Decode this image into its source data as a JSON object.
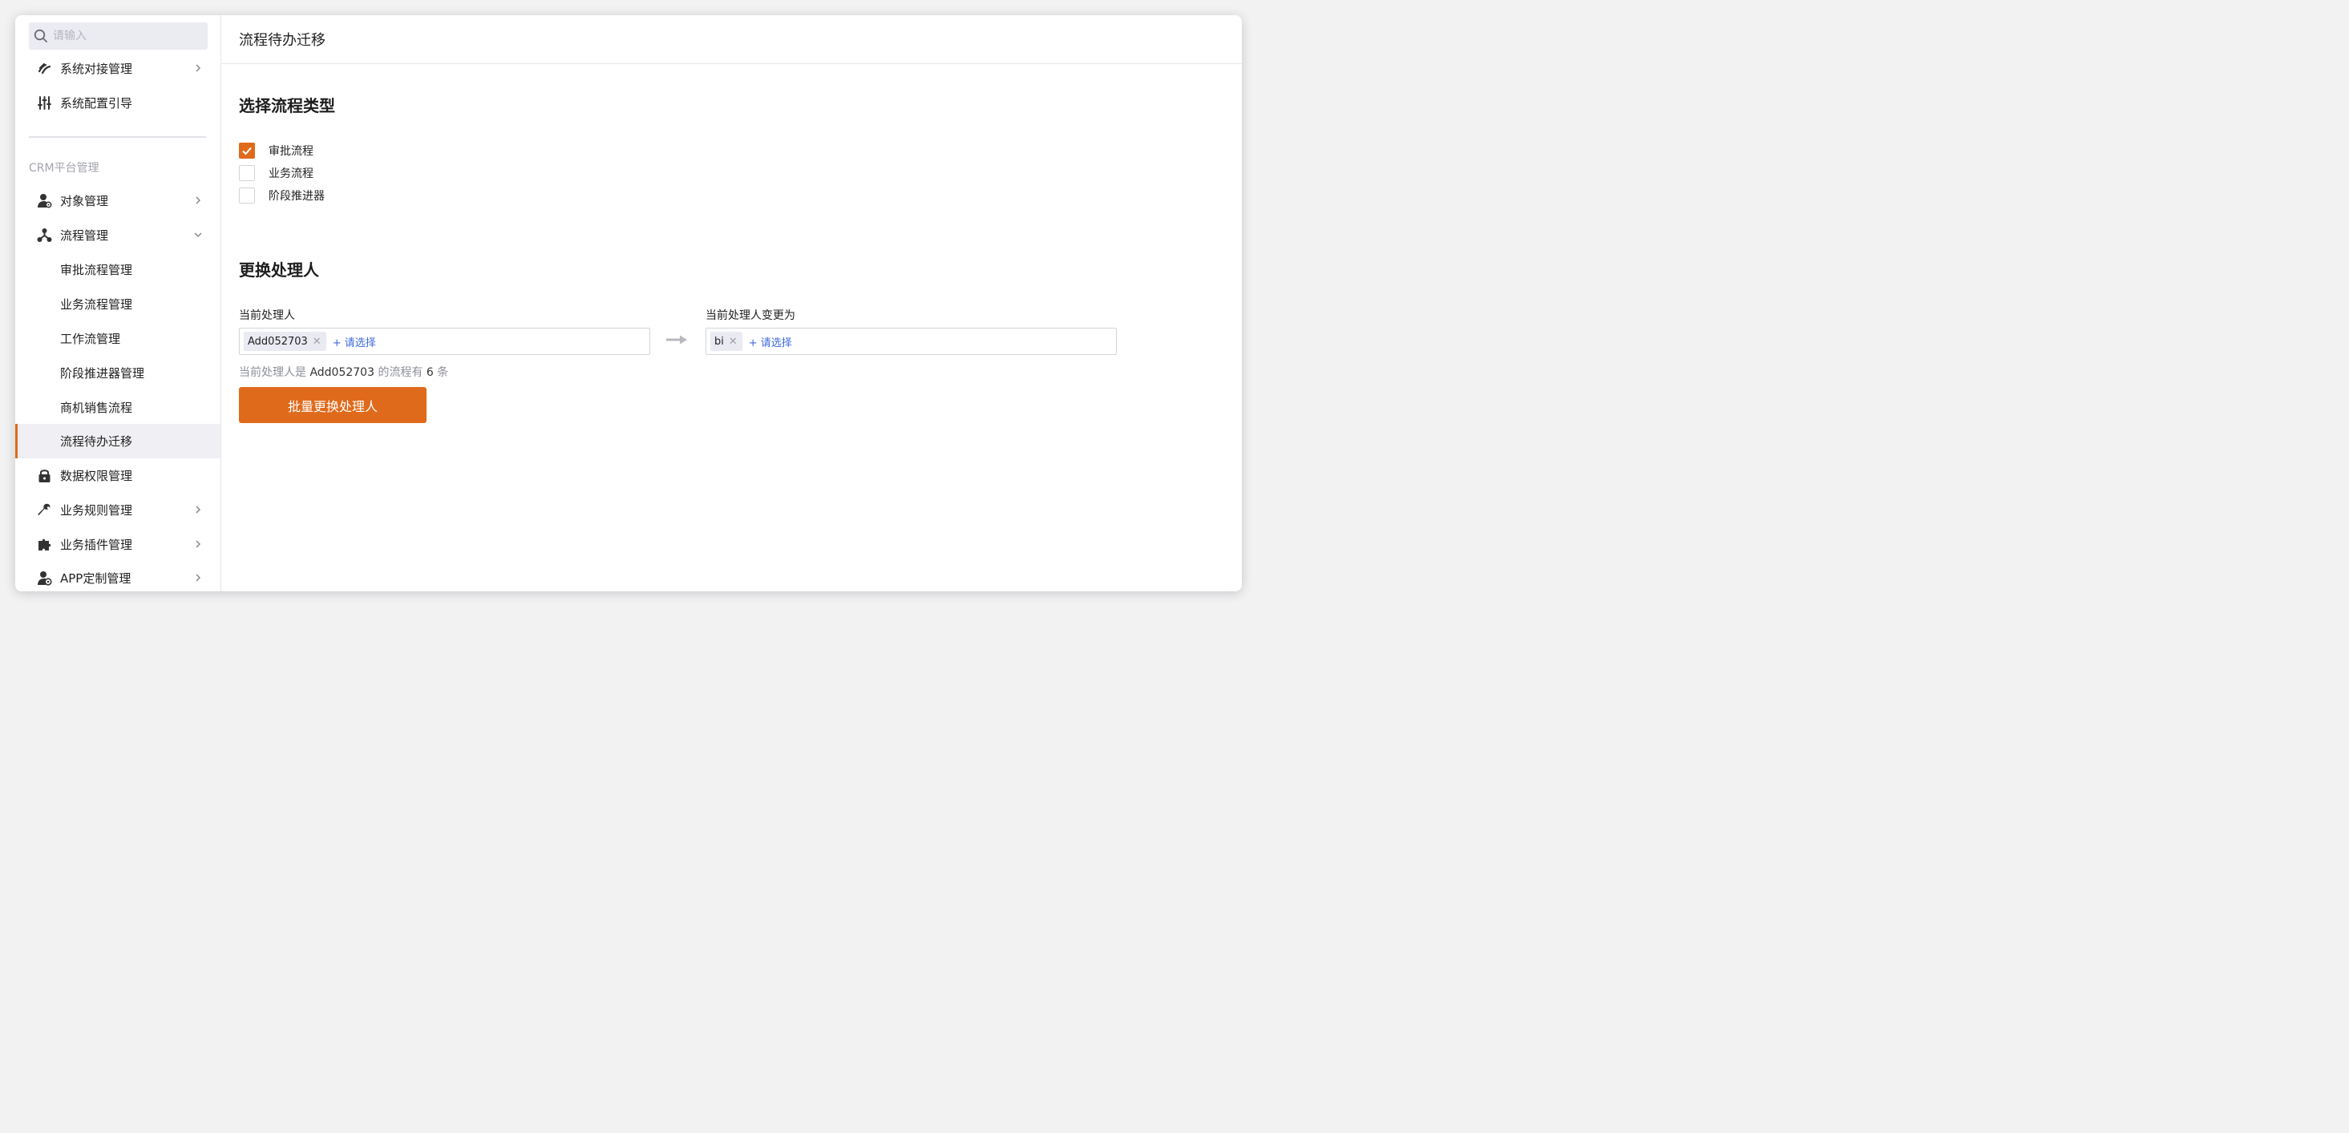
{
  "colors": {
    "accent": "#e06a1b",
    "link": "#3d6adf",
    "muted": "#a3a5ad"
  },
  "sidebar": {
    "search": {
      "placeholder": "请输入",
      "icon": "search-icon"
    },
    "top_items": [
      {
        "label": "系统对接管理",
        "icon": "link-icon",
        "has_chevron": true
      },
      {
        "label": "系统配置引导",
        "icon": "sliders-icon",
        "has_chevron": false
      }
    ],
    "section_title": "CRM平台管理",
    "items": [
      {
        "label": "对象管理",
        "icon": "user-gear-icon",
        "has_chevron": true
      },
      {
        "label": "流程管理",
        "icon": "flow-icon",
        "expanded": true
      },
      {
        "label": "审批流程管理"
      },
      {
        "label": "业务流程管理"
      },
      {
        "label": "工作流管理"
      },
      {
        "label": "阶段推进器管理"
      },
      {
        "label": "商机销售流程"
      },
      {
        "label": "流程待办迁移",
        "active": true
      },
      {
        "label": "数据权限管理",
        "icon": "lock-icon"
      },
      {
        "label": "业务规则管理",
        "icon": "wrench-icon",
        "has_chevron": true
      },
      {
        "label": "业务插件管理",
        "icon": "puzzle-icon",
        "has_chevron": true
      },
      {
        "label": "APP定制管理",
        "icon": "app-gear-icon",
        "has_chevron": true
      }
    ]
  },
  "main": {
    "title": "流程待办迁移",
    "section1": {
      "heading": "选择流程类型",
      "options": [
        {
          "label": "审批流程",
          "checked": true
        },
        {
          "label": "业务流程",
          "checked": false
        },
        {
          "label": "阶段推进器",
          "checked": false
        }
      ]
    },
    "section2": {
      "heading": "更换处理人",
      "current_label": "当前处理人",
      "current_tag": "Add052703",
      "new_label": "当前处理人变更为",
      "new_tag": "bi",
      "add_link": "+ 请选择",
      "info_prefix": "当前处理人是",
      "info_user": "Add052703",
      "info_middle": "的流程有",
      "info_count": "6",
      "info_suffix": "条",
      "button": "批量更换处理人"
    }
  }
}
